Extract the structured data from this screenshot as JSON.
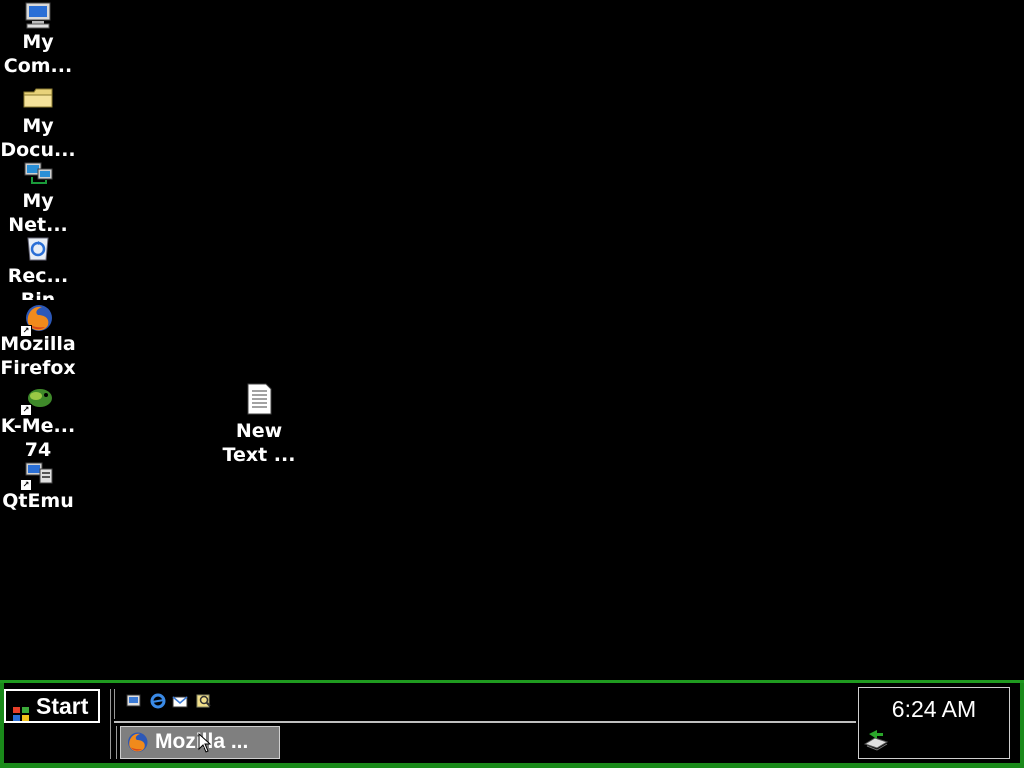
{
  "desktop": {
    "icons": [
      {
        "name": "my-computer",
        "label": "My\nCom...",
        "icon": "computer-icon"
      },
      {
        "name": "my-documents",
        "label": "My\nDocu...",
        "icon": "folder-icon"
      },
      {
        "name": "my-network",
        "label": "My\nNet...",
        "icon": "network-icon"
      },
      {
        "name": "recycle-bin",
        "label": "Rec...\nBin",
        "icon": "recycle-bin-icon"
      },
      {
        "name": "mozilla-firefox",
        "label": "Mozilla\nFirefox",
        "icon": "firefox-icon"
      },
      {
        "name": "k-meleon",
        "label": "K-Me...\n74",
        "icon": "k-meleon-icon"
      },
      {
        "name": "qtemu",
        "label": "QtEmu",
        "icon": "qtemu-icon"
      },
      {
        "name": "new-text-document",
        "label": "New\nText ...",
        "icon": "text-document-icon"
      }
    ]
  },
  "taskbar": {
    "start_label": "Start",
    "quick_launch": [
      "show-desktop-icon",
      "internet-explorer-icon",
      "outlook-express-icon",
      "search-icon"
    ],
    "task_button_label": "Mozilla ...",
    "clock": "6:24 AM",
    "tray_icon": "network-connection-icon"
  },
  "colors": {
    "background": "#000000",
    "taskbar_border": "#1a8a1a",
    "text": "#ffffff"
  }
}
